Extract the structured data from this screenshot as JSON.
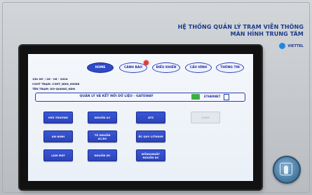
{
  "brand": {
    "title_line1": "HỆ THỐNG QUẢN LÝ TRẠM VIỄN THÔNG",
    "title_line2": "MÀN HÌNH TRUNG TÂM",
    "logo_text": "VIETTEL"
  },
  "nav": {
    "items": [
      {
        "label": "HOME"
      },
      {
        "label": "CẢNH BÁO"
      },
      {
        "label": "ĐIỀU KHIỂN"
      },
      {
        "label": "CẤU HÌNH"
      },
      {
        "label": "THÔNG TIN"
      }
    ],
    "active": "HOME",
    "alarm_color": "#e53935"
  },
  "info": {
    "datetime": "15h 06' / 26 - 06 - 2024",
    "csht": "CSHT TRẠM: CSHT_NDH_00086",
    "station": "TÊN TRẠM: DO-QUANG_NDH"
  },
  "gateway": {
    "title": "QUẢN LÝ VÀ KẾT NỐI DỮ LIỆU - GATEWAY",
    "eth_label": "ETHERNET",
    "status_color": "#3cb043"
  },
  "tiles": [
    {
      "label": "MÔI TRƯỜNG"
    },
    {
      "label": "NGUỒN AC"
    },
    {
      "label": "ATS"
    },
    {
      "label": "GIÁM",
      "disabled": true
    },
    {
      "label": "AN NINH"
    },
    {
      "label": "TỦ NGUỒN AC/DC"
    },
    {
      "label": "ẮC QUY LITHIUM"
    },
    {
      "label": "LÀM MÁT"
    },
    {
      "label": "NGUỒN DC"
    },
    {
      "label": "ĐỒNG/NGẮT NGUỒN DC"
    }
  ],
  "colors": {
    "accent": "#2f49c8",
    "tile": "#3957d9",
    "cabinet": "#c4c8cc"
  }
}
